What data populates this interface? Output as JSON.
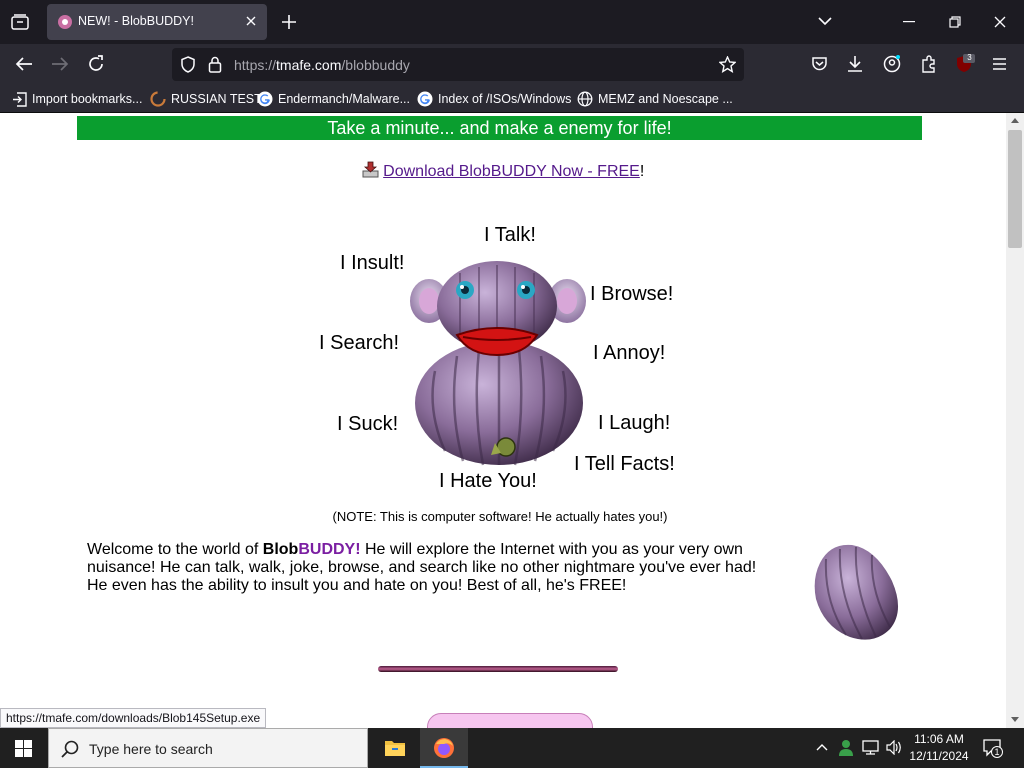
{
  "browser": {
    "tab_title": "NEW! - BlobBUDDY!",
    "url_scheme": "https://",
    "url_host": "tmafe.com",
    "url_path": "/blobbuddy",
    "ublock_badge": "3",
    "bookmarks": [
      {
        "label": "Import bookmarks...",
        "icon": "import-icon"
      },
      {
        "label": "RUSSIAN TEST",
        "icon": "site-icon"
      },
      {
        "label": "Endermanch/Malware...",
        "icon": "google-icon"
      },
      {
        "label": "Index of /ISOs/Windows",
        "icon": "google-icon"
      },
      {
        "label": "MEMZ and Noescape ...",
        "icon": "globe-icon"
      }
    ],
    "status_url": "https://tmafe.com/downloads/Blob145Setup.exe"
  },
  "page": {
    "banner_text": "Take a minute... and make a enemy for life!",
    "download_link": "Download BlobBUDDY Now - FREE",
    "download_suffix": "!",
    "words": {
      "talk": "I Talk!",
      "insult": "I Insult!",
      "browse": "I Browse!",
      "search": "I Search!",
      "annoy": "I Annoy!",
      "suck": "I Suck!",
      "laugh": "I Laugh!",
      "tell_facts": "I Tell Facts!",
      "hate": "I Hate You!"
    },
    "note": "(NOTE: This is computer software! He actually hates you!)",
    "welcome_prefix": "Welcome to the world of ",
    "welcome_blob": "Blob",
    "welcome_buddy": "BUDDY!",
    "welcome_rest": " He will explore the Internet with you as your very own nuisance!  He can talk, walk, joke, browse, and search like no other nightmare you've ever had! He even has the ability to insult you and hate on you! Best of all, he's FREE!"
  },
  "taskbar": {
    "search_placeholder": "Type here to search",
    "time": "11:06 AM",
    "date": "12/11/2024",
    "notification_count": "1"
  },
  "colors": {
    "banner_green": "#0a9e2f",
    "link_purple": "#551a8b",
    "buddy_purple": "#7b1fa2",
    "blob_purple": "#8a6d9a"
  }
}
